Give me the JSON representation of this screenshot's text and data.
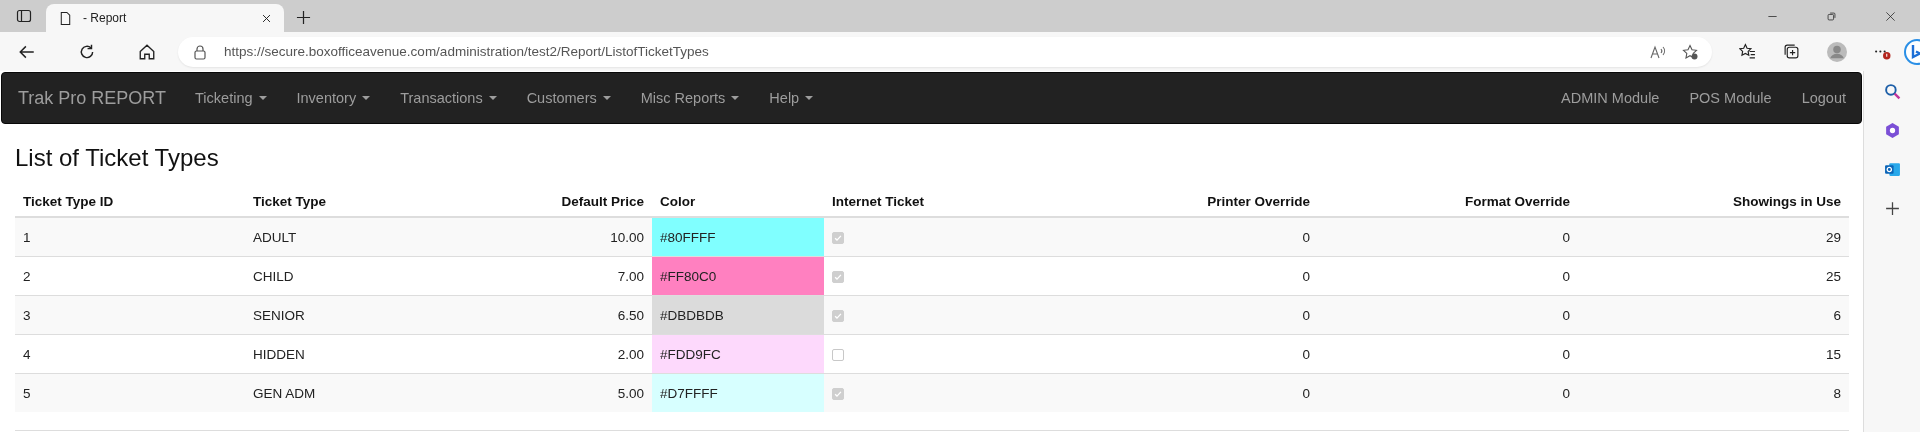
{
  "browser": {
    "tab_title": "- Report",
    "url": "https://secure.boxofficeavenue.com/administration/test2/Report/ListofTicketTypes"
  },
  "navbar": {
    "brand": "Trak Pro REPORT",
    "menus": [
      {
        "label": "Ticketing"
      },
      {
        "label": "Inventory"
      },
      {
        "label": "Transactions"
      },
      {
        "label": "Customers"
      },
      {
        "label": "Misc Reports"
      },
      {
        "label": "Help"
      }
    ],
    "links": [
      "ADMIN Module",
      "POS Module",
      "Logout"
    ]
  },
  "page_title": "List of Ticket Types",
  "table": {
    "columns": [
      "Ticket Type ID",
      "Ticket Type",
      "Default Price",
      "Color",
      "Internet Ticket",
      "Printer Override",
      "Format Override",
      "Showings in Use"
    ],
    "rows": [
      {
        "id": "1",
        "type": "ADULT",
        "price": "10.00",
        "color_text": "#80FFFF",
        "color": "#80ffff",
        "internet": true,
        "printer": "0",
        "format": "0",
        "showings": "29"
      },
      {
        "id": "2",
        "type": "CHILD",
        "price": "7.00",
        "color_text": "#FF80C0",
        "color": "#ff80c0",
        "internet": true,
        "printer": "0",
        "format": "0",
        "showings": "25"
      },
      {
        "id": "3",
        "type": "SENIOR",
        "price": "6.50",
        "color_text": "#DBDBDB",
        "color": "#dbdbdb",
        "internet": true,
        "printer": "0",
        "format": "0",
        "showings": "6"
      },
      {
        "id": "4",
        "type": "HIDDEN",
        "price": "2.00",
        "color_text": "#FDD9FC",
        "color": "#fdd9fc",
        "internet": false,
        "printer": "0",
        "format": "0",
        "showings": "15"
      },
      {
        "id": "5",
        "type": "GEN ADM",
        "price": "5.00",
        "color_text": "#D7FFFF",
        "color": "#d7ffff",
        "internet": true,
        "printer": "0",
        "format": "0",
        "showings": "8"
      }
    ]
  }
}
